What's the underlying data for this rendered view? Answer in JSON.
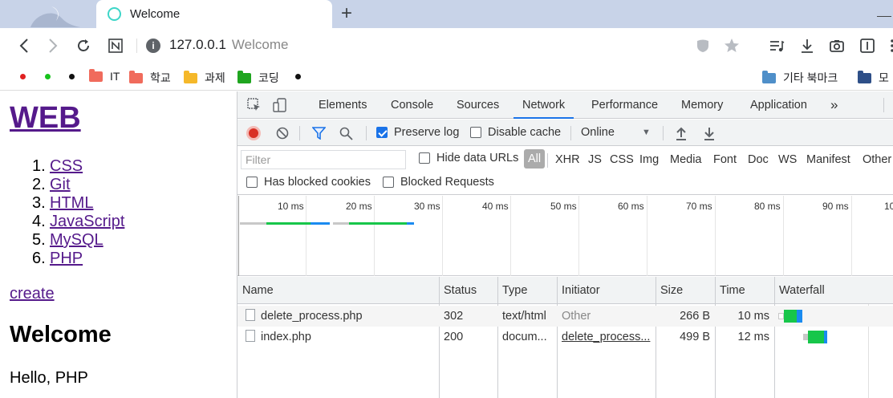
{
  "browser": {
    "tab_title": "Welcome",
    "url": "127.0.0.1",
    "page_title_in_omnibox": "Welcome"
  },
  "bookmarks": {
    "items": [
      {
        "label": "IT",
        "color": "#f06b5c"
      },
      {
        "label": "학교",
        "color": "#f06b5c"
      },
      {
        "label": "과제",
        "color": "#f5b82a"
      },
      {
        "label": "코딩",
        "color": "#1fa51f"
      }
    ],
    "right_items": [
      {
        "label": "기타 북마크",
        "color": "#4f8fc9"
      },
      {
        "label": "모",
        "color": "#2e4f88"
      }
    ]
  },
  "page": {
    "heading": "WEB",
    "list": [
      {
        "num": "1.",
        "label": "CSS"
      },
      {
        "num": "2.",
        "label": "Git"
      },
      {
        "num": "3.",
        "label": "HTML"
      },
      {
        "num": "4.",
        "label": "JavaScript"
      },
      {
        "num": "5.",
        "label": "MySQL"
      },
      {
        "num": "6.",
        "label": "PHP"
      }
    ],
    "create_link": "create",
    "title": "Welcome",
    "body": "Hello, PHP"
  },
  "devtools": {
    "tabs": [
      "Elements",
      "Console",
      "Sources",
      "Network",
      "Performance",
      "Memory",
      "Application"
    ],
    "active_tab": "Network",
    "network": {
      "preserve_log": "Preserve log",
      "disable_cache": "Disable cache",
      "throttle": "Online",
      "filter_placeholder": "Filter",
      "hide_data_urls": "Hide data URLs",
      "types": [
        "All",
        "XHR",
        "JS",
        "CSS",
        "Img",
        "Media",
        "Font",
        "Doc",
        "WS",
        "Manifest",
        "Other"
      ],
      "has_blocked_cookies": "Has blocked cookies",
      "blocked_requests": "Blocked Requests",
      "ticks": [
        "10 ms",
        "20 ms",
        "30 ms",
        "40 ms",
        "50 ms",
        "60 ms",
        "70 ms",
        "80 ms",
        "90 ms",
        "10"
      ],
      "columns": [
        "Name",
        "Status",
        "Type",
        "Initiator",
        "Size",
        "Time",
        "Waterfall"
      ],
      "rows": [
        {
          "name": "delete_process.php",
          "status": "302",
          "type": "text/html",
          "initiator": "Other",
          "size": "266 B",
          "time": "10 ms"
        },
        {
          "name": "index.php",
          "status": "200",
          "type": "docum...",
          "initiator": "delete_process...",
          "size": "499 B",
          "time": "12 ms"
        }
      ]
    }
  }
}
